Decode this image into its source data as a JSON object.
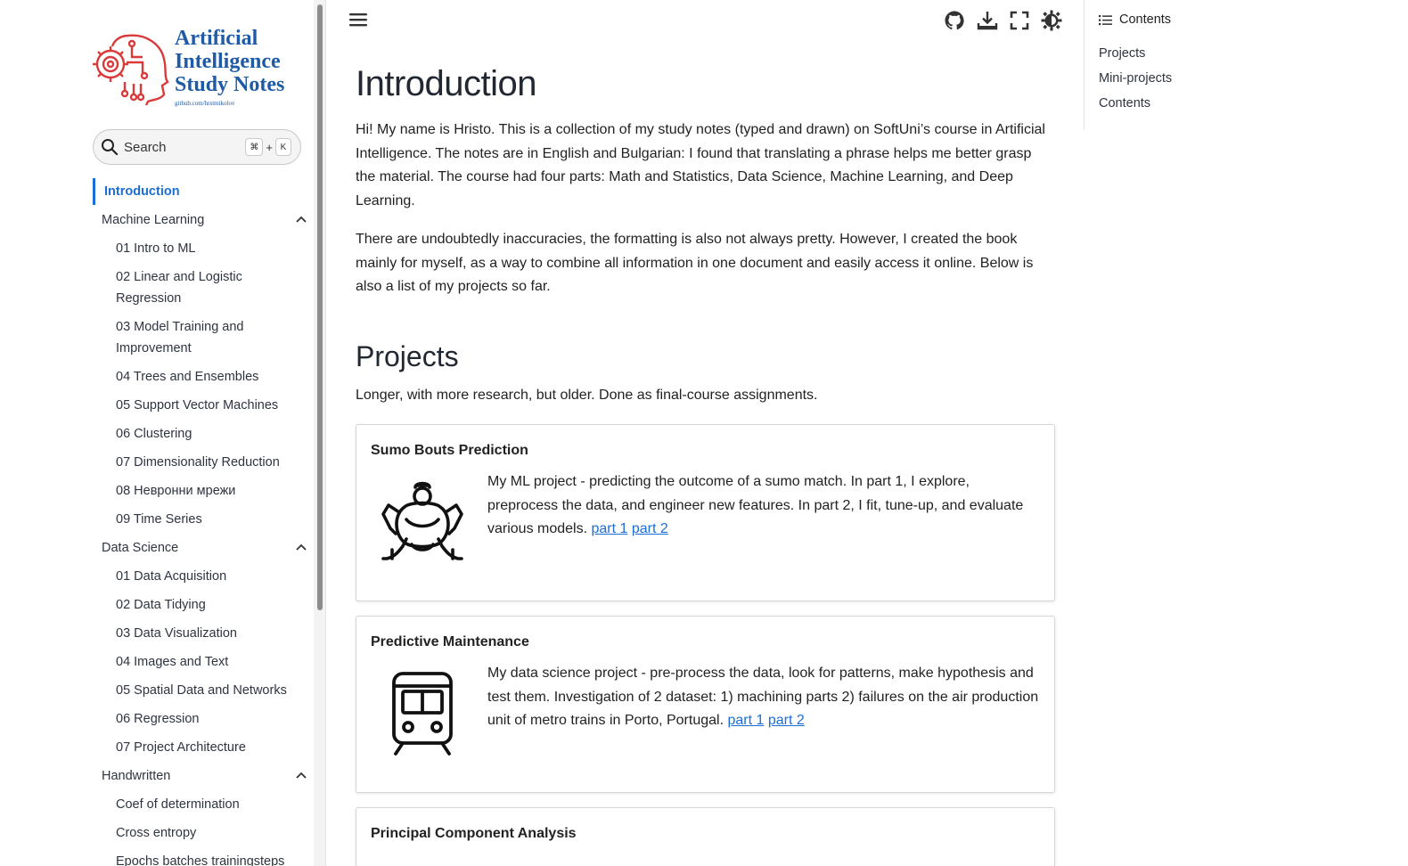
{
  "logo": {
    "lines": [
      "Artificial",
      "Intelligence",
      "Study Notes"
    ],
    "subtitle": "github.com/hrstmikolov"
  },
  "search": {
    "label": "Search",
    "key1": "⌘",
    "plus": "+",
    "key2": "K"
  },
  "sidebar": {
    "active": "Introduction",
    "sections": [
      {
        "label": "Machine Learning",
        "items": [
          "01 Intro to ML",
          "02 Linear and Logistic Regression",
          "03 Model Training and Improvement",
          "04 Trees and Ensembles",
          "05 Support Vector Machines",
          "06 Clustering",
          "07 Dimensionality Reduction",
          "08 Невронни мрежи",
          "09 Time Series"
        ]
      },
      {
        "label": "Data Science",
        "items": [
          "01 Data Acquisition",
          "02 Data Tidying",
          "03 Data Visualization",
          "04 Images and Text",
          "05 Spatial Data and Networks",
          "06 Regression",
          "07 Project Architecture"
        ]
      },
      {
        "label": "Handwritten",
        "items": [
          "Coef of determination",
          "Cross entropy",
          "Epochs batches trainingsteps"
        ]
      }
    ]
  },
  "toolbar": {
    "icons": [
      "menu-icon",
      "github-icon",
      "download-icon",
      "fullscreen-icon",
      "theme-icon"
    ]
  },
  "main": {
    "title": "Introduction",
    "intro_p1": "Hi! My name is Hristo. This is a collection of my study notes (typed and drawn) on SoftUni’s course in Artificial Intelligence. The notes are in English and Bulgarian: I found that translating a phrase helps me better grasp the material. The course had four parts: Math and Statistics, Data Science, Machine Learning, and Deep Learning.",
    "intro_p2": "There are undoubtedly inaccuracies, the formatting is also not always pretty. However, I created the book mainly for myself, as a way to combine all information in one document and easily access it online. Below is also a list of my projects so far.",
    "projects_heading": "Projects",
    "projects_desc": "Longer, with more research, but older. Done as final-course assignments.",
    "cards": [
      {
        "title": "Sumo Bouts Prediction",
        "text": "My ML project - predicting the outcome of a sumo match. In part 1, I explore, preprocess the data, and engineer new features. In part 2, I fit, tune-up, and evaluate various models.",
        "link1": "part 1",
        "link2": "part 2"
      },
      {
        "title": "Predictive Maintenance",
        "text": "My data science project - pre-process the data, look for patterns, make hypothesis and test them. Investigation of 2 dataset: 1) machining parts 2) failures on the air production unit of metro trains in Porto, Portugal.",
        "link1": "part 1",
        "link2": "part 2"
      },
      {
        "title": "Principal Component Analysis"
      }
    ]
  },
  "toc": {
    "heading": "Contents",
    "items": [
      "Projects",
      "Mini-projects",
      "Contents"
    ]
  },
  "colors": {
    "accent": "#1c6ed6",
    "logo_red": "#d93a3a",
    "logo_blue": "#1f5aa6"
  }
}
